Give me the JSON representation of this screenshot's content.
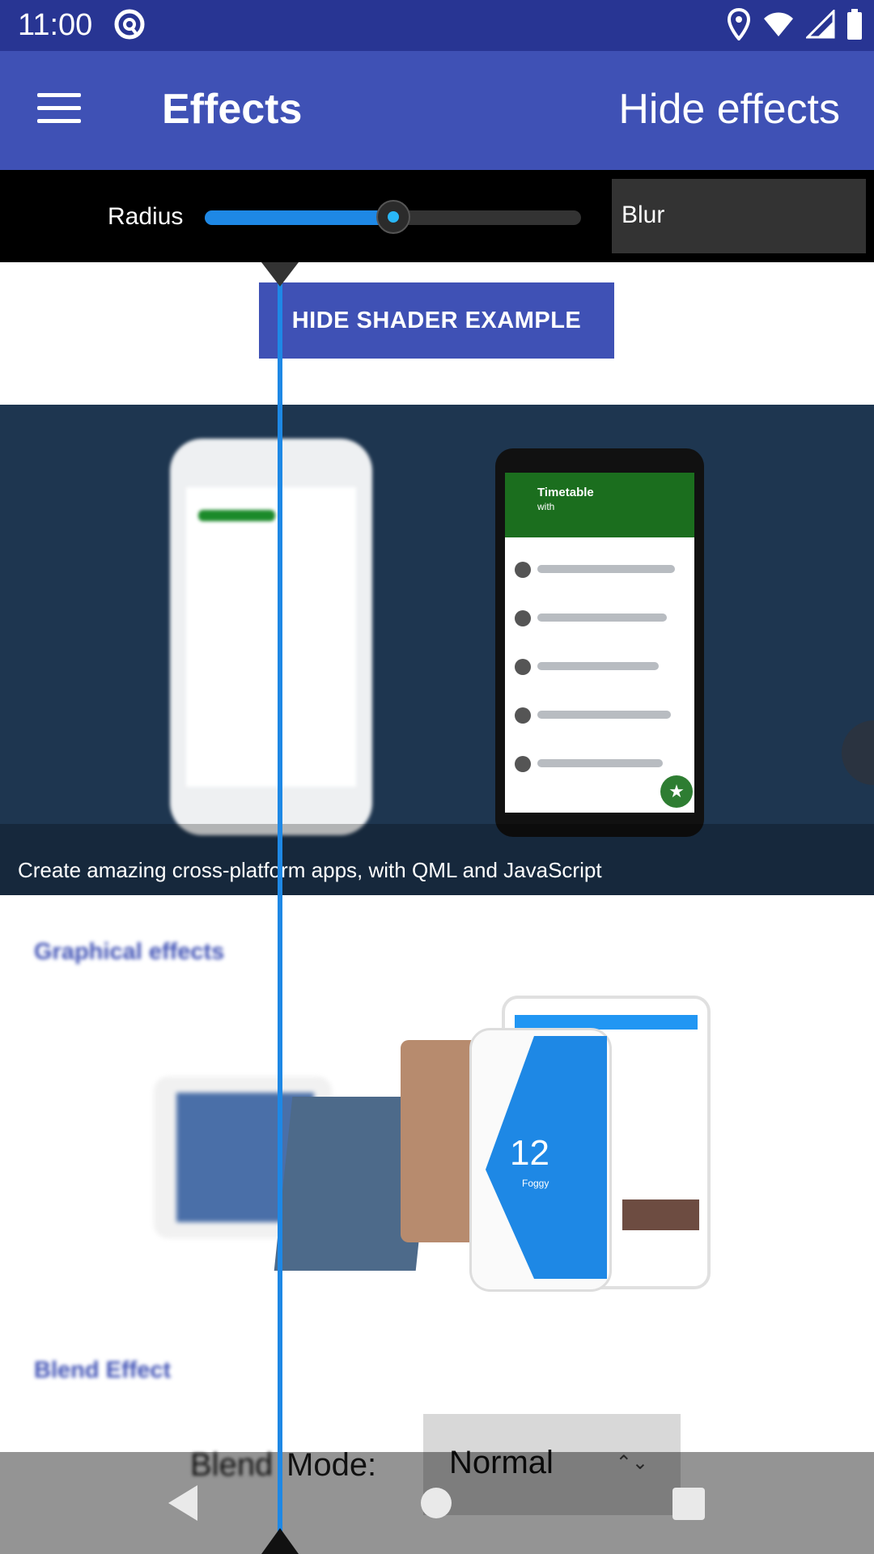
{
  "status_bar": {
    "time": "11:00"
  },
  "app_bar": {
    "title": "Effects",
    "action": "Hide effects"
  },
  "controls": {
    "radius_label": "Radius",
    "radius_value": 0.5,
    "effect": "Blur"
  },
  "shader_button": "HIDE SHADER EXAMPLE",
  "banner": {
    "caption": "Create amazing cross-platform apps, with QML and JavaScript",
    "phone_title": "Timetable",
    "phone_tab": "with"
  },
  "sections": {
    "graphical": "Graphical effects",
    "blend": "Blend Effect"
  },
  "weather": {
    "temp": "12",
    "label": "Foggy"
  },
  "blend": {
    "prefix": "Blend",
    "label": "Mode:",
    "value": "Normal"
  },
  "colors": {
    "primary": "#3f51b5",
    "primary_dark": "#283593",
    "accent": "#1e88e5"
  }
}
